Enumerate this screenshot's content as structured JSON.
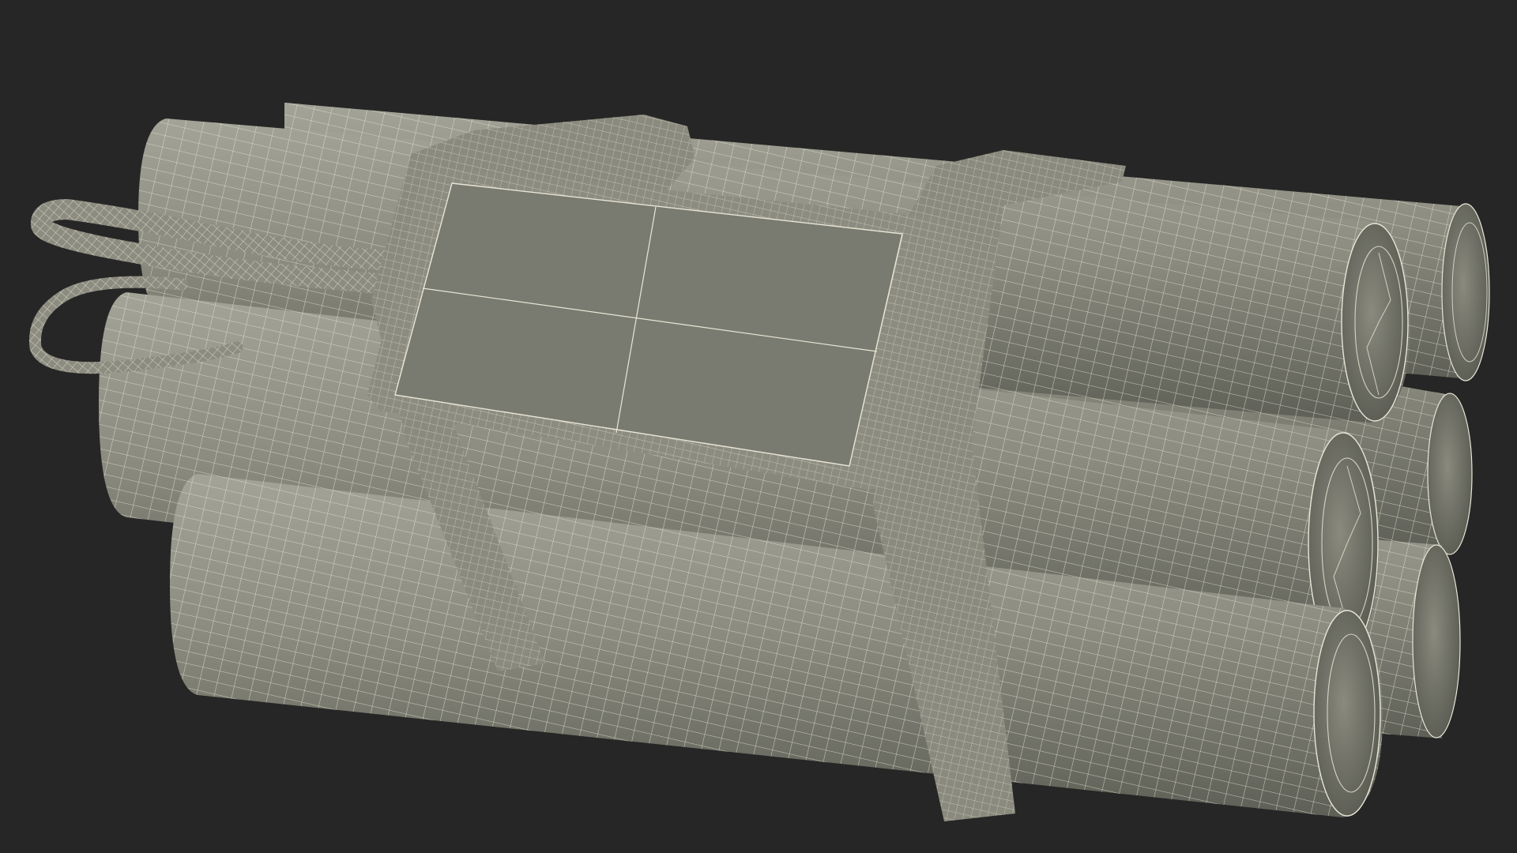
{
  "viewport": {
    "background": "#262626"
  },
  "model": {
    "subject": "dynamite-bundle-wireframe",
    "render_style": "wireframe-on-clay",
    "surface_color": "#8c8c80",
    "surface_shadow": "#5e5f56",
    "surface_highlight": "#a3a497",
    "wire_color": "#e8e6d6",
    "stick_count": 6,
    "strap_count": 2
  }
}
